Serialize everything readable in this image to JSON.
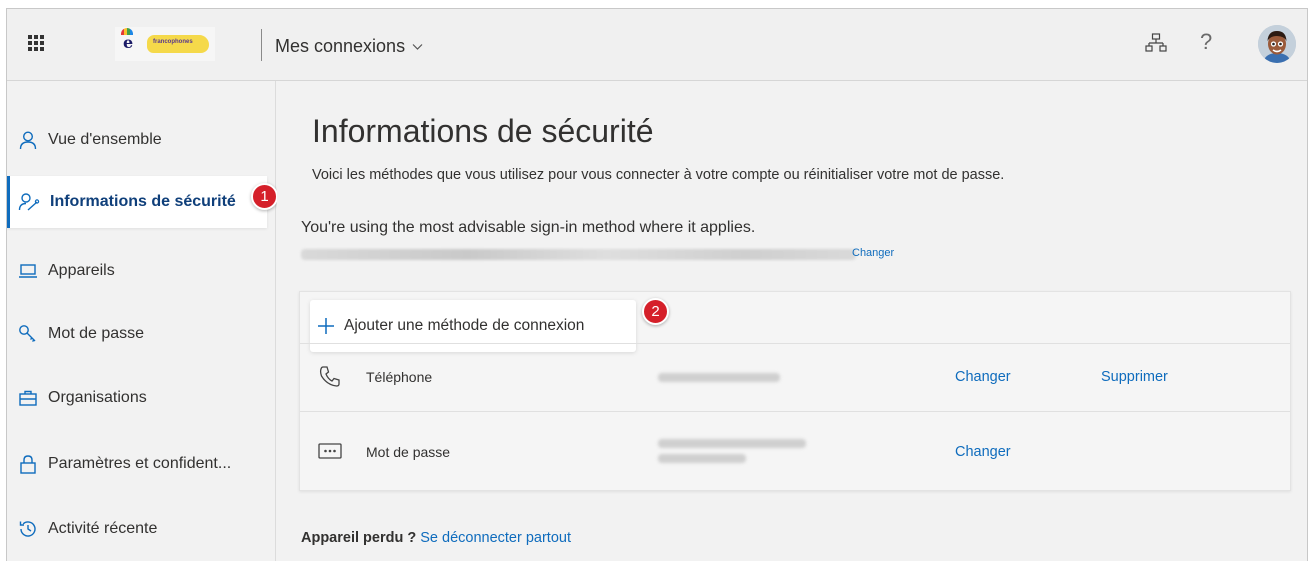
{
  "header": {
    "app_title": "Mes connexions",
    "org_logo_text": "francophones",
    "icons": [
      "waffle-icon",
      "organization-icon",
      "help-icon",
      "avatar"
    ],
    "help_glyph": "?"
  },
  "sidebar": {
    "items": [
      {
        "label": "Vue d'ensemble",
        "icon": "person-icon"
      },
      {
        "label": "Informations de sécurité",
        "icon": "security-info-icon",
        "active": true
      },
      {
        "label": "Appareils",
        "icon": "laptop-icon"
      },
      {
        "label": "Mot de passe",
        "icon": "key-icon"
      },
      {
        "label": "Organisations",
        "icon": "briefcase-icon"
      },
      {
        "label": "Paramètres et confident...",
        "icon": "lock-icon"
      },
      {
        "label": "Activité récente",
        "icon": "history-icon"
      }
    ]
  },
  "annotations": {
    "badge_1": "1",
    "badge_2": "2"
  },
  "main": {
    "title": "Informations de sécurité",
    "subtitle": "Voici les méthodes que vous utilisez pour vous connecter à votre compte ou réinitialiser votre mot de passe.",
    "advisable_text": "You're using the most advisable sign-in method where it applies.",
    "default_method_change": "Changer",
    "add_method_label": "Ajouter une méthode de connexion",
    "methods": [
      {
        "name": "Téléphone",
        "icon": "phone-icon",
        "change": "Changer",
        "delete": "Supprimer"
      },
      {
        "name": "Mot de passe",
        "icon": "password-icon",
        "change": "Changer"
      }
    ],
    "lost_device_label": "Appareil perdu ?",
    "lost_device_link": "Se déconnecter partout"
  },
  "colors": {
    "accent": "#0f6cbd",
    "badge": "#d5202a",
    "background": "#f2f2f2"
  }
}
